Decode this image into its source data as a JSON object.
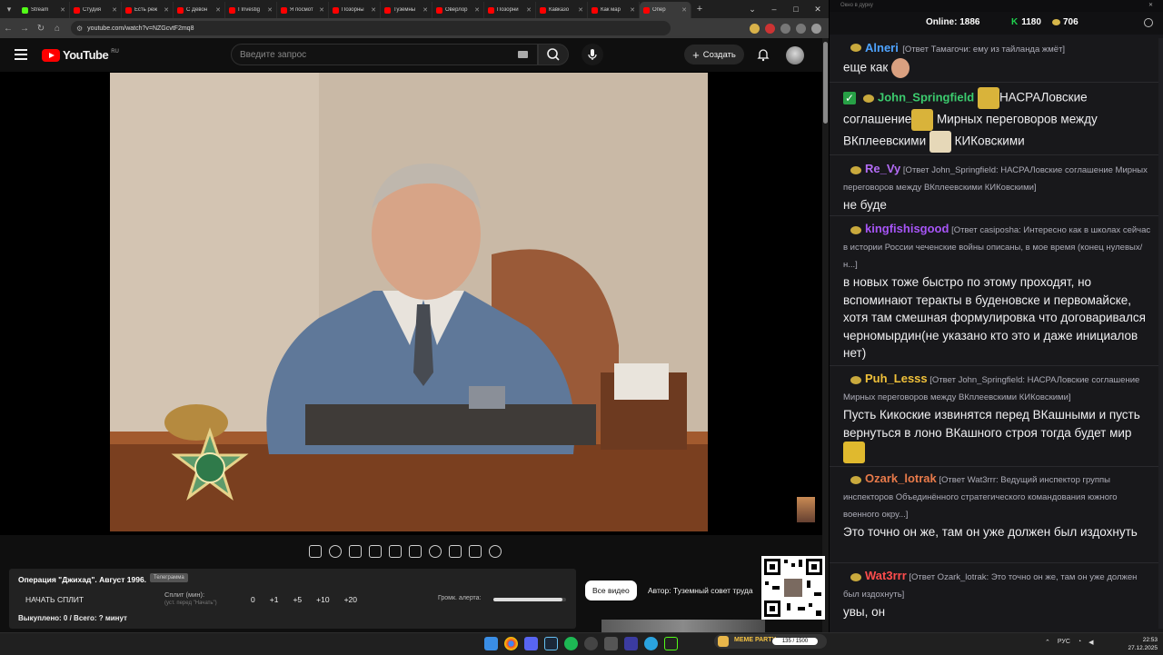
{
  "browser": {
    "tabs": [
      {
        "title": "Stream",
        "color": "#53fc18"
      },
      {
        "title": "Студия",
        "color": "#ff0000"
      },
      {
        "title": "Есть реж",
        "color": "#ff0000"
      },
      {
        "title": "С Девон",
        "color": "#ff0000"
      },
      {
        "title": "I Investig",
        "color": "#ff0000"
      },
      {
        "title": "Я посмот",
        "color": "#ff0000"
      },
      {
        "title": "Позорны",
        "color": "#ff0000"
      },
      {
        "title": "Туземны",
        "color": "#ff0000"
      },
      {
        "title": "Оверлор",
        "color": "#ff0000"
      },
      {
        "title": "Позорни",
        "color": "#ff0000"
      },
      {
        "title": "Кавказо",
        "color": "#ff0000"
      },
      {
        "title": "Как мар",
        "color": "#ff0000"
      },
      {
        "title": "Опер",
        "color": "#ff0000"
      }
    ],
    "url": "youtube.com/watch?v=NZGcvtF2mq8"
  },
  "youtube": {
    "logo_text": "YouTube",
    "region": "RU",
    "search_placeholder": "Введите запрос",
    "create_label": "Создать"
  },
  "widget": {
    "title": "Операция \"Джихад\". Август 1996.",
    "badge": "Телеграмма",
    "split_button": "НАЧАТЬ СПЛИТ",
    "split_label": "Сплит (мин):",
    "split_hint": "(уст. перед \"Начать\")",
    "values": [
      "0",
      "+1",
      "+5",
      "+10",
      "+20"
    ],
    "volume_label": "Громк. алерта:",
    "volume_level": 0.95,
    "bought": "Выкуплено: 0 / Всего: ? минут"
  },
  "chips": {
    "all_videos": "Все видео",
    "author": "Автор: Туземный совет труда"
  },
  "chat": {
    "top_label": "Окно в дурку",
    "online_label": "Online:",
    "online_count": "1886",
    "k_count": "1180",
    "coins": "706",
    "messages": [
      {
        "user": "Alneri",
        "color": "#4ea3ff",
        "reply": "[Ответ Тамагочи: ему из тайланда жмёт]",
        "text": "еще как"
      },
      {
        "user": "John_Springfield",
        "color": "#3ccb6e",
        "text_a": "НАСРАЛовские",
        "text_b": "соглашение",
        "text_c": "Мирных переговоров между",
        "text_d": "ВКплеевскими",
        "text_e": "КИКовскими"
      },
      {
        "user": "Re_Vy",
        "color": "#b36cf5",
        "reply": "[Ответ John_Springfield: НАСРАЛовские соглашение Мирных переговоров между ВКплеевскими КИКовскими]",
        "text": "не буде"
      },
      {
        "user": "kingfishisgood",
        "color": "#a755f7",
        "reply": "[Ответ casiposha: Интересно как в школах сейчас в истории России чеченские войны описаны, в мое время (конец нулевых/н...]",
        "text": "в новых тоже быстро по этому проходят, но вспоминают теракты в буденовске и первомайске, хотя там смешная формулировка что договаривался черномырдин(не указано кто это и даже инициалов нет)"
      },
      {
        "user": "Puh_Lesss",
        "color": "#f0c13a",
        "reply": "[Ответ John_Springfield: НАСРАЛовские соглашение Мирных переговоров между ВКплеевскими КИКовскими]",
        "text": "Пусть Кикоские извинятся перед ВКашными и пусть вернуться в лоно ВКашного строя тогда будет мир"
      },
      {
        "user": "Ozark_lotrak",
        "color": "#e87a4a",
        "reply": "[Ответ Wat3rrr: Ведущий инспектор группы инспекторов Объединённого стратегического командования южного военного окру...]",
        "text": "Это точно он же, там он уже должен был издохнуть"
      },
      {
        "user": "Wat3rrr",
        "color": "#ff4d4d",
        "reply": "[Ответ Ozark_lotrak: Это точно он же, там он уже должен был издохнуть]",
        "text": "увы, он"
      }
    ]
  },
  "taskbar": {
    "timer_tag": "MEME PARTY",
    "timer_value": "135 / 1500",
    "lang": "РУС",
    "time": "22:53",
    "date": "27.12.2025"
  }
}
